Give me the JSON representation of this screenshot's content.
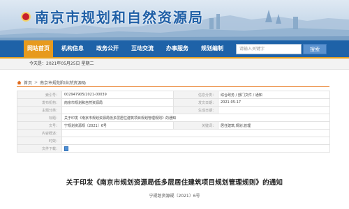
{
  "header": {
    "site_title": "南京市规划和自然资源局"
  },
  "nav": {
    "items": [
      {
        "label": "网站首页",
        "active": true
      },
      {
        "label": "机构信息",
        "active": false
      },
      {
        "label": "政务公开",
        "active": false
      },
      {
        "label": "互动交流",
        "active": false
      },
      {
        "label": "办事服务",
        "active": false
      },
      {
        "label": "规划编制",
        "active": false
      }
    ],
    "search_placeholder": "请输入关键字",
    "search_button": "搜索"
  },
  "date_bar": {
    "text": "今天是：2021年05月25日 星期二"
  },
  "breadcrumb": {
    "home": "首页",
    "separator": ">",
    "current": "南京市规划和自然资源局"
  },
  "info_table": {
    "rows": [
      {
        "l1": "索引号：",
        "v1": "002947905/2021-00039",
        "l2": "信息分类：",
        "v2": "综合政务 / 部门文件 / 通知"
      },
      {
        "l1": "发布机构：",
        "v1": "南京市规划和自然资源局",
        "l2": "发文日期：",
        "v2": "2021-05-17"
      },
      {
        "l1": "主题分类：",
        "v1": "",
        "l2": "生成日期：",
        "v2": ""
      },
      {
        "l1": "标题：",
        "v1": "关于印发《南京市规划资源局低多层居住建筑项目规划管理规则》的通知",
        "l2": "",
        "v2": ""
      },
      {
        "l1": "文号：",
        "v1": "宁规划资源规〔2021〕6号",
        "l2": "关键词：",
        "v2": "居住建筑,规划,管理"
      },
      {
        "l1": "内容概述：",
        "v1": "",
        "l2": "",
        "v2": ""
      },
      {
        "l1": "时效：",
        "v1": "",
        "l2": "",
        "v2": ""
      },
      {
        "l1": "文件下载：",
        "v1": "",
        "l2": "",
        "v2": ""
      }
    ]
  },
  "document": {
    "title": "关于印发《南京市规划资源局低多层居住建筑项目规划管理规则》的通知",
    "number": "宁规划资源规〔2021〕6号"
  },
  "colors": {
    "nav_bg": "#1e62a8",
    "nav_active": "#e79a1e",
    "accent_line": "#e97f2a",
    "title_blue": "#1f5fa6"
  }
}
